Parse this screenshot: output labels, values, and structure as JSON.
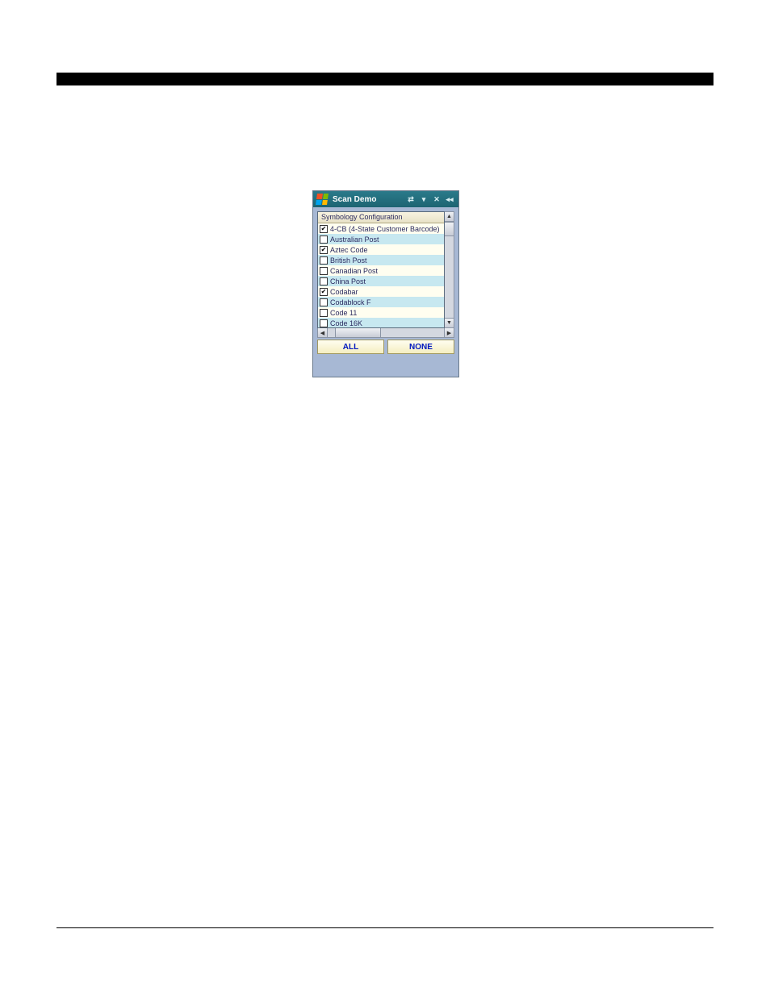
{
  "titlebar": {
    "title": "Scan Demo"
  },
  "list": {
    "header": "Symbology Configuration",
    "rows": [
      {
        "label": "4-CB (4-State Customer Barcode)",
        "checked": true
      },
      {
        "label": "Australian Post",
        "checked": false
      },
      {
        "label": "Aztec Code",
        "checked": true
      },
      {
        "label": "British Post",
        "checked": false
      },
      {
        "label": "Canadian Post",
        "checked": false
      },
      {
        "label": "China Post",
        "checked": false
      },
      {
        "label": "Codabar",
        "checked": true
      },
      {
        "label": "Codablock F",
        "checked": false
      },
      {
        "label": "Code 11",
        "checked": false
      },
      {
        "label": "Code 16K",
        "checked": false
      }
    ]
  },
  "buttons": {
    "all": "ALL",
    "none": "NONE"
  }
}
